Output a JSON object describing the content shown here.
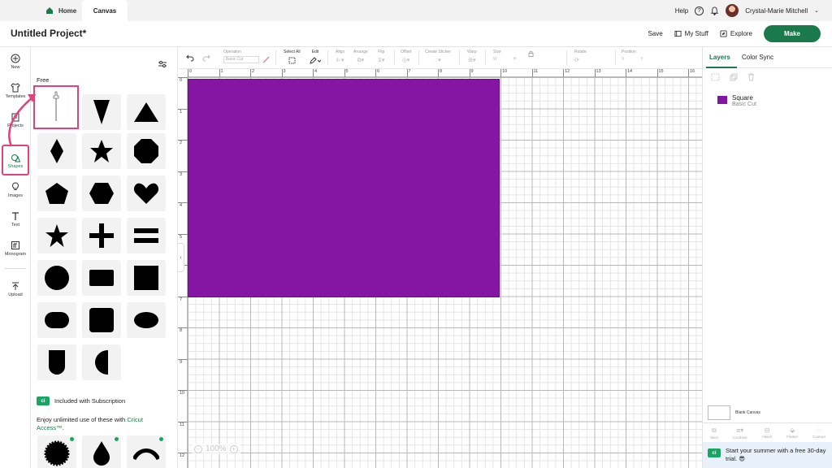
{
  "topbar": {
    "home_label": "Home",
    "canvas_label": "Canvas",
    "help_label": "Help",
    "user_name": "Crystal-Marie Mitchell"
  },
  "header": {
    "project_title": "Untitled Project*",
    "save_label": "Save",
    "my_stuff_label": "My Stuff",
    "explore_label": "Explore",
    "make_label": "Make"
  },
  "leftrail": {
    "items": [
      {
        "label": "New",
        "icon": "plus-circle-icon"
      },
      {
        "label": "Templates",
        "icon": "shirt-icon"
      },
      {
        "label": "Projects",
        "icon": "projects-icon"
      },
      {
        "label": "Shapes",
        "icon": "shapes-icon"
      },
      {
        "label": "Images",
        "icon": "lightbulb-icon"
      },
      {
        "label": "Text",
        "icon": "text-icon"
      },
      {
        "label": "Monogram",
        "icon": "monogram-icon"
      },
      {
        "label": "Upload",
        "icon": "upload-icon"
      }
    ],
    "active": "Shapes"
  },
  "shapes_panel": {
    "free_label": "Free",
    "subscription_label": "Included with Subscription",
    "enjoy_text": "Enjoy unlimited use of these with ",
    "access_link": "Cricut Access™",
    "access_suffix": ".",
    "shapes": [
      "line",
      "triangle-down",
      "triangle",
      "diamond",
      "star-5",
      "octagon",
      "pentagon",
      "hexagon",
      "heart",
      "star-5-sharp",
      "plus",
      "equals",
      "circle",
      "rectangle-rounded",
      "square",
      "stadium",
      "square-rounded",
      "ellipse",
      "arch-bottom",
      "half-circle"
    ]
  },
  "toolbar": {
    "operation_label": "Operation",
    "operation_value": "Basic Cut",
    "select_all_label": "Select All",
    "edit_label": "Edit",
    "align_label": "Align",
    "arrange_label": "Arrange",
    "flip_label": "Flip",
    "offset_label": "Offset",
    "create_sticker_label": "Create Sticker",
    "warp_label": "Warp",
    "size_label": "Size",
    "rotate_label": "Rotate",
    "position_label": "Position",
    "size_w": "W",
    "size_h": "H",
    "pos_x": "X",
    "pos_y": "Y"
  },
  "ruler": {
    "top_ticks": [
      "0",
      "1",
      "2",
      "3",
      "4",
      "5",
      "6",
      "7",
      "8",
      "9",
      "10",
      "11",
      "12",
      "13",
      "14",
      "15",
      "16"
    ],
    "left_ticks": [
      "0",
      "1",
      "2",
      "3",
      "4",
      "5",
      "6",
      "7",
      "8",
      "9",
      "10",
      "11",
      "12"
    ]
  },
  "canvas": {
    "zoom_label": "100%",
    "square_color": "#8516a3"
  },
  "rightpanel": {
    "tab_layers": "Layers",
    "tab_color_sync": "Color Sync",
    "layer_name": "Square",
    "layer_operation": "Basic Cut",
    "blank_canvas_label": "Blank Canvas",
    "bottom_tools": [
      "Slice",
      "Combine",
      "Attach",
      "Flatten",
      "Contour"
    ],
    "promo_text": "Start your summer with a free 30-day trial. 😎"
  },
  "colors": {
    "accent": "#1a7a4c",
    "highlight": "#e0427a",
    "shape_purple": "#8516a3"
  }
}
